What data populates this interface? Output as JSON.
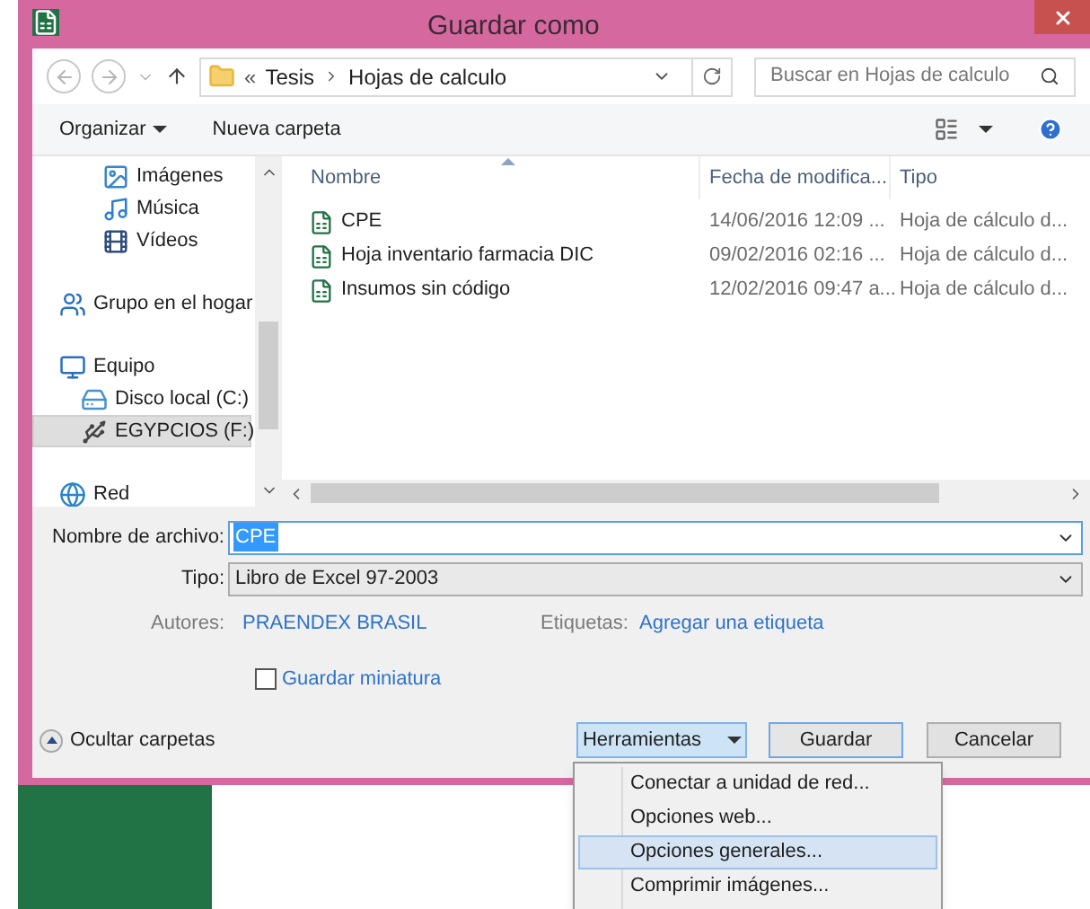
{
  "window": {
    "title": "Guardar como"
  },
  "nav": {
    "path": [
      {
        "label": "«",
        "kind": "overflow"
      },
      {
        "label": "Tesis",
        "kind": "folder"
      },
      {
        "label": "Hojas de calculo",
        "kind": "folder"
      }
    ],
    "search": {
      "placeholder": "Buscar en Hojas de calculo"
    }
  },
  "toolbar": {
    "organize": "Organizar",
    "new_folder": "Nueva carpeta"
  },
  "sidebar": {
    "items": [
      {
        "children": [
          {
            "label": "Imágenes",
            "kind": "images",
            "selected": false
          },
          {
            "label": "Música",
            "kind": "music",
            "selected": false
          },
          {
            "label": "Vídeos",
            "kind": "videos",
            "selected": false
          }
        ]
      },
      {
        "label": "Grupo en el hogar",
        "kind": "homegroup",
        "selected": false
      },
      {
        "label": "Equipo",
        "kind": "computer",
        "selected": false,
        "children": [
          {
            "label": "Disco local (C:)",
            "kind": "disk",
            "selected": false
          },
          {
            "label": "EGYPCIOS (F:)",
            "kind": "drive",
            "selected": true
          }
        ]
      },
      {
        "label": "Red",
        "kind": "network",
        "selected": false
      }
    ]
  },
  "files": {
    "columns": [
      "Nombre",
      "Fecha de modifica...",
      "Tipo"
    ],
    "rows": [
      {
        "name": "CPE",
        "date": "14/06/2016 12:09 ...",
        "type": "Hoja de cálculo d..."
      },
      {
        "name": "Hoja inventario farmacia DIC",
        "date": "09/02/2016 02:16 ...",
        "type": "Hoja de cálculo d..."
      },
      {
        "name": "Insumos sin código",
        "date": "12/02/2016 09:47 a...",
        "type": "Hoja de cálculo d..."
      }
    ]
  },
  "form": {
    "filename_label": "Nombre de archivo:",
    "filename": "CPE",
    "type_label": "Tipo:",
    "type": "Libro de Excel 97-2003",
    "authors_label": "Autores:",
    "authors": "PRAENDEX BRASIL",
    "tags_label": "Etiquetas:",
    "tags": "Agregar una etiqueta",
    "thumbnail": {
      "label": "Guardar miniatura",
      "checked": false
    }
  },
  "footer": {
    "hide_folders": "Ocultar carpetas",
    "tools": {
      "label": "Herramientas",
      "expanded": true
    },
    "save": "Guardar",
    "cancel": "Cancelar"
  },
  "menu": [
    {
      "label": "Conectar a unidad de red...",
      "selected": false
    },
    {
      "label": "Opciones web...",
      "selected": false
    },
    {
      "label": "Opciones generales...",
      "selected": true
    },
    {
      "label": "Comprimir imágenes...",
      "selected": false
    }
  ]
}
